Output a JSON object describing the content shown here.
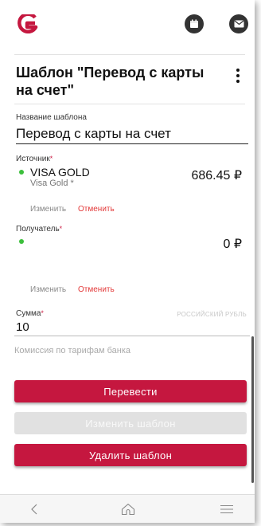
{
  "header": {
    "logo_icon": "bank-logo-icon",
    "calendar_icon": "calendar-icon",
    "mail_icon": "mail-icon"
  },
  "page": {
    "title": "Шаблон \"Перевод с карты на счет\"",
    "menu_icon": "more-vertical-icon"
  },
  "template_name": {
    "label": "Название шаблона",
    "value": "Перевод с карты на счет"
  },
  "source": {
    "label": "Источник",
    "required_mark": "*",
    "card_name": "VISA GOLD",
    "card_sub": "Visa Gold *",
    "amount": "686.45 ₽",
    "change_label": "Изменить",
    "cancel_label": "Отменить"
  },
  "recipient": {
    "label": "Получатель",
    "required_mark": "*",
    "amount": "0 ₽",
    "change_label": "Изменить",
    "cancel_label": "Отменить"
  },
  "sum": {
    "label": "Сумма",
    "required_mark": "*",
    "currency": "РОССИЙСКИЙ РУБЛЬ",
    "value": "10"
  },
  "commission_note": "Комиссия по тарифам банка",
  "buttons": {
    "transfer": "Перевести",
    "edit_template": "Изменить шаблон",
    "delete_template": "Удалить шаблон"
  },
  "navbar": {
    "back_icon": "back-icon",
    "home_icon": "home-icon",
    "menu_icon": "menu-icon"
  },
  "colors": {
    "brand": "#c5173f",
    "status_dot": "#3cbf3c",
    "cancel_link": "#e33a3a",
    "disabled": "#e1e1e1"
  }
}
